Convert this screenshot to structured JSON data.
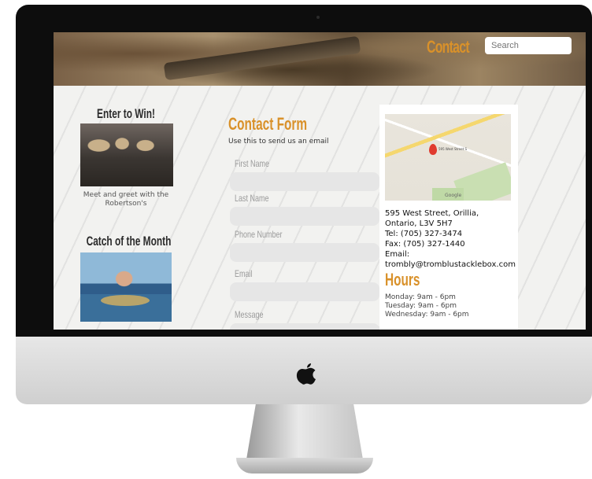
{
  "header": {
    "nav_contact": "Contact",
    "search_placeholder": "Search"
  },
  "sidebar": {
    "enter_title": "Enter to Win!",
    "enter_caption": "Meet and greet with the Robertson's",
    "catch_title": "Catch of the Month"
  },
  "form": {
    "title": "Contact Form",
    "subtitle": "Use this to send us an email",
    "fields": {
      "first_name": "First Name",
      "last_name": "Last Name",
      "phone": "Phone Number",
      "email": "Email",
      "message": "Message"
    }
  },
  "contact": {
    "address_line1": "595 West Street, Orillia,",
    "address_line2": "Ontario, L3V 5H7",
    "tel": "Tel: (705) 327-3474",
    "fax": "Fax: (705) 327-1440",
    "email_label": "Email:",
    "email": "trombly@tromblustacklebox.com",
    "map_label": "595 West Street S",
    "map_attribution": "Google"
  },
  "hours": {
    "title": "Hours",
    "monday": "Monday: 9am - 6pm",
    "tuesday": "Tuesday: 9am - 6pm",
    "wednesday": "Wednesday: 9am - 6pm"
  }
}
